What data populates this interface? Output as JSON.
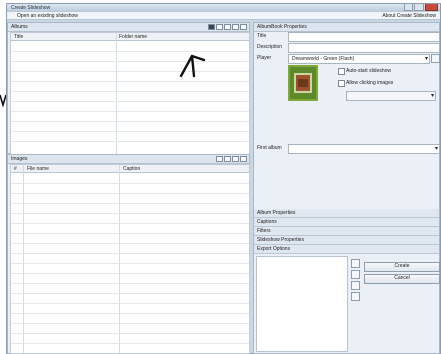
{
  "window": {
    "title": "Create Slideshow",
    "toolbar_left": "Open an existing slideshow",
    "toolbar_right": "About Create Slideshow"
  },
  "albums": {
    "header": "Albums",
    "columns": [
      "Title",
      "Folder name"
    ]
  },
  "images": {
    "header": "Images",
    "columns": [
      "#",
      "File name",
      "Caption"
    ]
  },
  "properties": {
    "header": "AlbumBook Properties",
    "title_label": "Title",
    "title_value": "",
    "description_label": "Description",
    "description_value": "",
    "player_label": "Player",
    "player_value": "Dreamworld - Green (Flash)",
    "autostart_label": "Auto-start slideshow",
    "autostart_checked": false,
    "clicking_label": "Allow clicking images",
    "clicking_checked": false,
    "first_album_label": "First album",
    "first_album_value": ""
  },
  "sections": [
    "Album Properties",
    "Captions",
    "Filters",
    "Slideshow Properties",
    "Export Options"
  ],
  "actions": {
    "create_label": "Create",
    "cancel_label": "Cancel"
  }
}
